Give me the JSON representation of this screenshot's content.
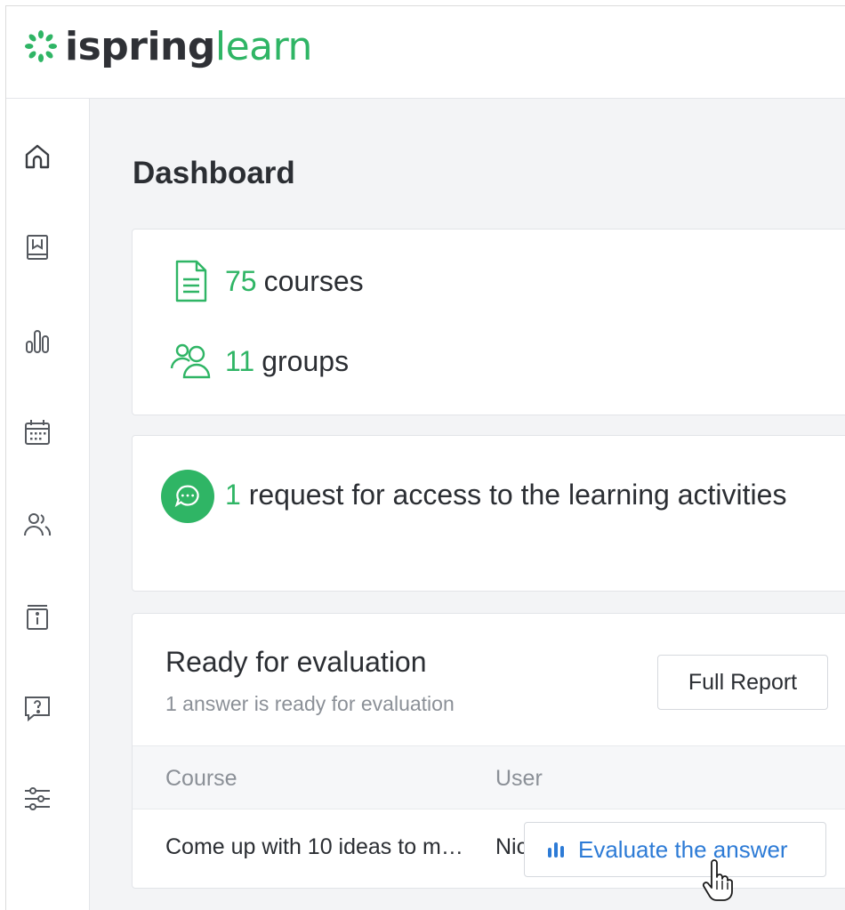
{
  "brand": {
    "name_part1": "ispring",
    "name_part2": "learn",
    "accent": "#2fb565"
  },
  "sidebar": {
    "items": [
      {
        "icon": "home-icon"
      },
      {
        "icon": "book-icon"
      },
      {
        "icon": "bar-chart-icon"
      },
      {
        "icon": "calendar-icon"
      },
      {
        "icon": "users-icon"
      },
      {
        "icon": "info-book-icon"
      },
      {
        "icon": "help-chat-icon"
      },
      {
        "icon": "sliders-icon"
      }
    ]
  },
  "page": {
    "title": "Dashboard"
  },
  "summary": {
    "courses": {
      "count": "75",
      "label": "courses"
    },
    "groups": {
      "count": "11",
      "label": "groups"
    }
  },
  "requests": {
    "count": "1",
    "text": "request for access to the learning activities"
  },
  "evaluation": {
    "title": "Ready for evaluation",
    "subtitle": "1 answer is ready for evaluation",
    "full_report_label": "Full Report",
    "columns": [
      "Course",
      "User"
    ],
    "rows": [
      {
        "course": "Come up with 10 ideas to m…",
        "user": "Nic",
        "action": "Evaluate the answer"
      }
    ]
  },
  "colors": {
    "primary_text": "#2b2e33",
    "muted_text": "#8b9097",
    "link_blue": "#2d7bd6"
  }
}
